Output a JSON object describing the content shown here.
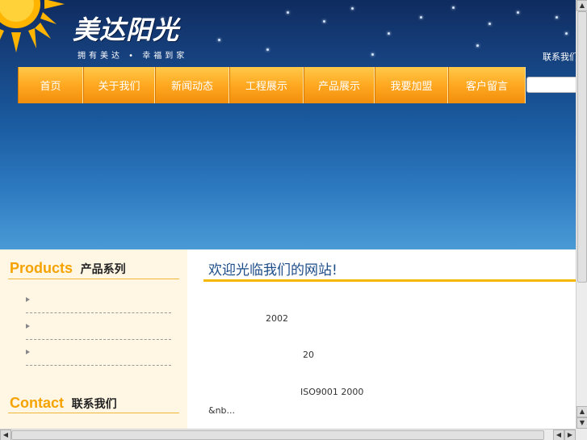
{
  "header": {
    "logo_text": "美达阳光",
    "slogan": "拥有美达 • 幸福到家",
    "contact_link": "联系我们"
  },
  "nav": {
    "items": [
      {
        "label": "首页"
      },
      {
        "label": "关于我们"
      },
      {
        "label": "新闻动态"
      },
      {
        "label": "工程展示"
      },
      {
        "label": "产品展示"
      },
      {
        "label": "我要加盟"
      },
      {
        "label": "客户留言"
      }
    ]
  },
  "sidebar": {
    "products_en": "Products",
    "products_cn": "产品系列",
    "contact_en": "Contact",
    "contact_cn": "联系我们"
  },
  "main": {
    "welcome_title": "欢迎光临我们的网站!",
    "lines": [
      "2002",
      "20",
      "ISO9001 2000",
      "&nb..."
    ]
  },
  "colors": {
    "nav_orange": "#ffa820",
    "accent_yellow": "#f5b800",
    "title_blue": "#1e4e8a"
  }
}
